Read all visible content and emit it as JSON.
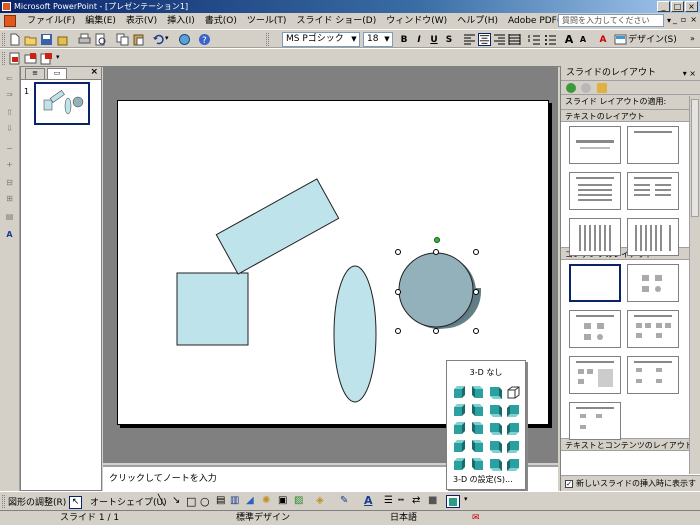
{
  "window": {
    "title": "Microsoft PowerPoint - [プレゼンテーション1]"
  },
  "menu": {
    "items": [
      "ファイル(F)",
      "編集(E)",
      "表示(V)",
      "挿入(I)",
      "書式(O)",
      "ツール(T)",
      "スライド ショー(D)",
      "ウィンドウ(W)",
      "ヘルプ(H)",
      "Adobe PDF(B)"
    ],
    "help_placeholder": "質問を入力してください"
  },
  "format": {
    "font": "MS Pゴシック",
    "size": "18",
    "bold": "B",
    "italic": "I",
    "underline": "U",
    "shadow": "S",
    "font_color": "A",
    "design": "デザイン(S)"
  },
  "thumbs": {
    "slide_number": "1"
  },
  "notes": {
    "placeholder": "クリックしてノートを入力"
  },
  "taskpane": {
    "title": "スライドのレイアウト",
    "apply_label": "スライド レイアウトの適用:",
    "section_text": "テキストのレイアウト",
    "section_content": "コンテンツのレイアウト",
    "section_text_content": "テキストとコンテンツのレイアウト",
    "footer_check": "新しいスライドの挿入時に表示する"
  },
  "threed": {
    "header": "3-D なし",
    "settings": "3-D の設定(S)..."
  },
  "draw": {
    "adjust": "図形の調整(R)",
    "autoshape": "オートシェイプ(U)"
  },
  "status": {
    "slide": "スライド 1 / 1",
    "design": "標準デザイン",
    "language": "日本語"
  },
  "colors": {
    "shape_fill": "#bfe3ea",
    "cylinder_fill": "#93b1ba",
    "accent": "#0a246a"
  }
}
